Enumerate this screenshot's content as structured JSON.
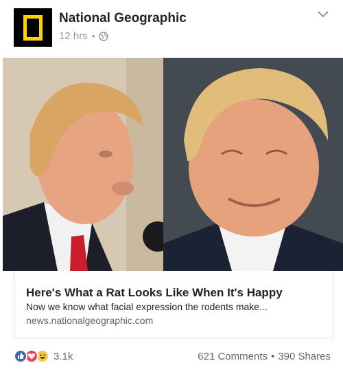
{
  "post": {
    "page_name": "National Geographic",
    "timestamp": "12 hrs",
    "separator": "•",
    "privacy_icon": "globe-icon",
    "menu_icon": "chevron-down-icon",
    "brand_color": "#ffd200"
  },
  "link": {
    "title": "Here's What a Rat Looks Like When It's Happy",
    "description": "Now we know what facial expression the rodents make...",
    "domain": "news.nationalgeographic.com"
  },
  "footer": {
    "reactions": [
      "like-icon",
      "love-icon",
      "haha-icon"
    ],
    "reaction_count": "3.1k",
    "comments": "621 Comments",
    "separator": "•",
    "shares": "390 Shares"
  },
  "colors": {
    "like": "#4267b2",
    "love": "#f33e58",
    "haha": "#f7c94a",
    "meta_text": "#90949c"
  }
}
